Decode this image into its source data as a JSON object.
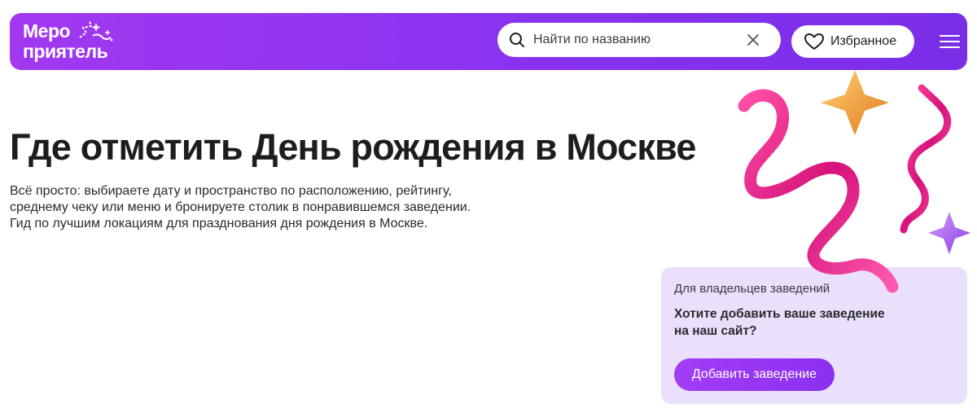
{
  "header": {
    "logo": {
      "line1": "Меро",
      "line2": "приятель"
    },
    "search": {
      "placeholder": "Найти по названию"
    },
    "favorites_label": "Избранное"
  },
  "main": {
    "title": "Где отметить День рождения в Москве",
    "description_lines": [
      "Всё просто: выбираете дату и пространство по расположению, рейтингу,",
      "среднему чеку или меню и бронируете столик в понравившемся заведении.",
      "Гид по лучшим локациям для празднования дня рождения в Москве."
    ]
  },
  "owner_card": {
    "subtitle": "Для владельцев заведений",
    "heading_lines": [
      "Хотите добавить ваше заведение",
      "на наш сайт?"
    ],
    "button_label": "Добавить заведение"
  },
  "colors": {
    "brand_purple": "#8a33f0",
    "card_background": "#ebe0fb",
    "ribbon_pink": "#e0207e",
    "star_gold": "#f0a030"
  }
}
